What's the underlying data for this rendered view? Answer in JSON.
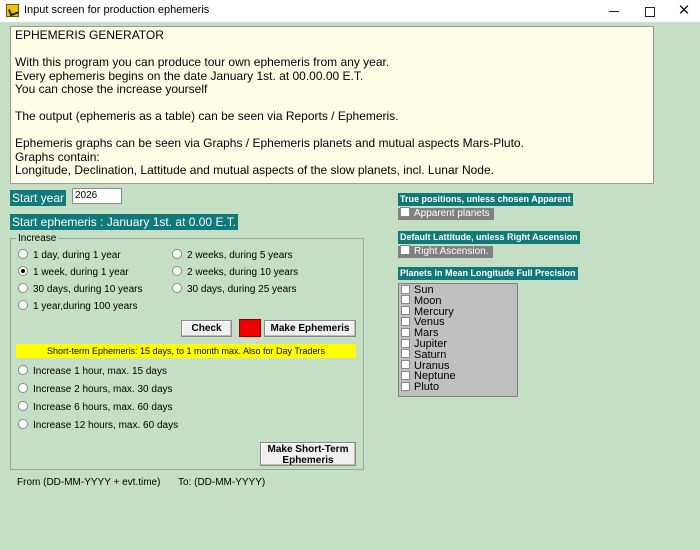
{
  "window": {
    "title": "Input screen for production ephemeris",
    "minimize_icon": "minimize-icon",
    "maximize_icon": "maximize-icon",
    "close_icon": "close-icon"
  },
  "info": {
    "heading": "EPHEMERIS GENERATOR",
    "lines": [
      "With this program you can produce tour own ephemeris from any  year.",
      "Every ephemeris begins on the date January 1st. at 00.00.00 E.T.",
      "You can chose the increase yourself",
      "The output (ephemeris as a table) can be seen via Reports / Ephemeris.",
      "Ephemeris graphs can be seen via Graphs / Ephemeris planets and mutual aspects Mars-Pluto.",
      "Graphs contain:",
      "Longitude, Declination, Lattitude and mutual aspects of the slow planets, incl. Lunar Node."
    ]
  },
  "start": {
    "year_label": "Start year",
    "year_value": "2026",
    "ephemeris_label": "Start ephemeris : January 1st. at 0.00 E.T."
  },
  "increase": {
    "legend": "Increase",
    "options": [
      {
        "label": "1 day, during 1 year",
        "selected": false
      },
      {
        "label": "1 week, during 1 year",
        "selected": true
      },
      {
        "label": "30 days, during 10 years",
        "selected": false
      },
      {
        "label": "1 year,during 100 years",
        "selected": false
      },
      {
        "label": "2 weeks, during 5 years",
        "selected": false
      },
      {
        "label": "2 weeks, during 10 years",
        "selected": false
      },
      {
        "label": "30 days, during 25 years",
        "selected": false
      }
    ],
    "check_button": "Check",
    "make_button": "Make Ephemeris",
    "indicator_color": "#ef0000"
  },
  "short_term": {
    "banner": "Short-term Ephemeris: 15 days,  to 1 month max.  Also for Day Traders",
    "options": [
      {
        "label": "Increase 1 hour, max. 15 days",
        "selected": false
      },
      {
        "label": "Increase 2 hours, max. 30 days",
        "selected": false
      },
      {
        "label": "Increase 6 hours, max. 60 days",
        "selected": false
      },
      {
        "label": "Increase 12 hours, max.  60 days",
        "selected": false
      }
    ],
    "button_line1": "Make Short-Term",
    "button_line2": "Ephemeris"
  },
  "range": {
    "from_label": "From (DD-MM-YYYY + evt.time)",
    "to_label": "To: (DD-MM-YYYY)"
  },
  "right": {
    "positions_label": "True positions, unless chosen Apparent",
    "apparent_checkbox": "Apparent planets",
    "latitude_label": "Default Lattitude, unless Right Ascension",
    "ascension_checkbox": "Right Ascension.",
    "planets_label": "Planets in Mean Longitude Full Precision",
    "planets": [
      "Sun",
      "Moon",
      "Mercury",
      "Venus",
      "Mars",
      "Jupiter",
      "Saturn",
      "Uranus",
      "Neptune",
      "Pluto"
    ]
  },
  "colors": {
    "background": "#c4dfc4",
    "info_background": "#ffffe8",
    "label_teal": "#107a7a",
    "banner_yellow": "#ffff00",
    "checkbox_gray": "#808080"
  }
}
